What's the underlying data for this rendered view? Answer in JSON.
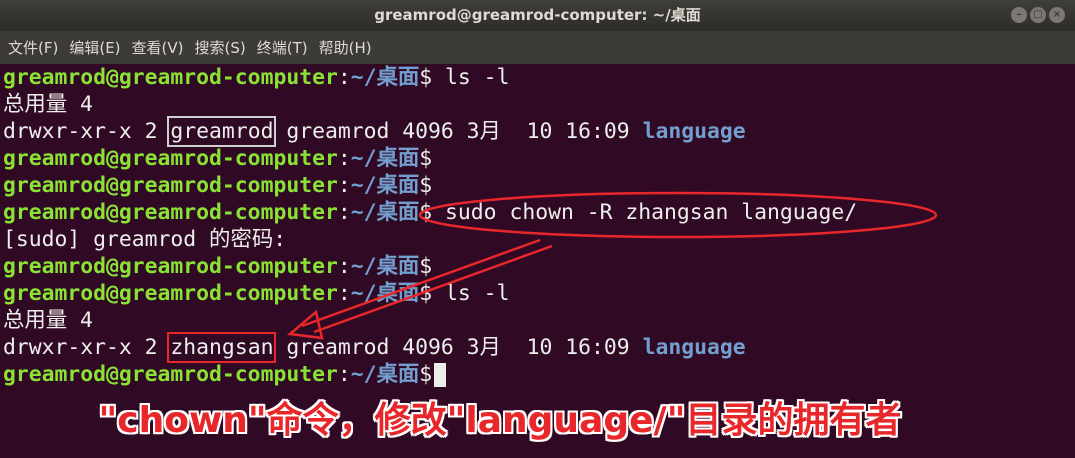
{
  "window": {
    "title": "greamrod@greamrod-computer: ~/桌面"
  },
  "menu": [
    "文件(F)",
    "编辑(E)",
    "查看(V)",
    "搜索(S)",
    "终端(T)",
    "帮助(H)"
  ],
  "prompt": {
    "user": "greamrod@greamrod-computer",
    "sep": ":",
    "path": "~/桌面",
    "sign": "$"
  },
  "lines": {
    "l1_cmd": " ls -l",
    "l2": "总用量 4",
    "l3_perm": "drwxr-xr-x 2 ",
    "l3_owner": "greamrod",
    "l3_rest": " greamrod 4096 3月  10 16:09 ",
    "l3_name": "language",
    "l6_cmd": " sudo chown -R zhangsan language/",
    "l7": "[sudo] greamrod 的密码:",
    "l10_cmd": " ls -l",
    "l11": "总用量 4",
    "l12_perm": "drwxr-xr-x 2 ",
    "l12_owner": "zhangsan",
    "l12_rest": " greamrod 4096 3月  10 16:09 ",
    "l12_name": "language"
  },
  "annotation": {
    "caption": "\"chown\"命令，修改\"language/\"目录的拥有者"
  },
  "colors": {
    "background": "#300a24",
    "prompt_user": "#8ae234",
    "prompt_path": "#729fcf",
    "annotation": "#e8272b"
  }
}
